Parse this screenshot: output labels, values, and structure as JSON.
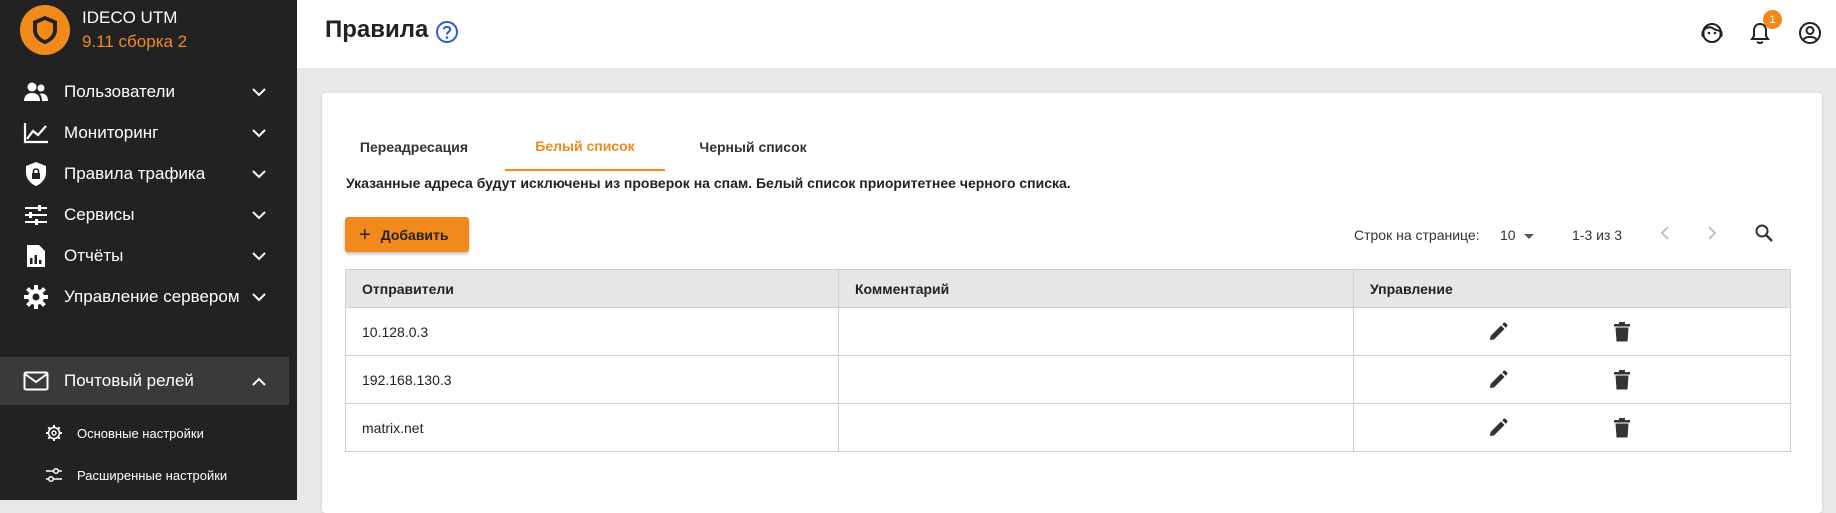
{
  "brand": {
    "name": "IDECO UTM",
    "version": "9.11 сборка 2"
  },
  "sidebar": {
    "items": [
      {
        "label": "Пользователи",
        "icon": "users-icon"
      },
      {
        "label": "Мониторинг",
        "icon": "chart-line-icon"
      },
      {
        "label": "Правила трафика",
        "icon": "shield-lock-icon"
      },
      {
        "label": "Сервисы",
        "icon": "sliders-icon"
      },
      {
        "label": "Отчёты",
        "icon": "report-icon"
      },
      {
        "label": "Управление сервером",
        "icon": "gear-icon"
      },
      {
        "label": "Почтовый релей",
        "icon": "mail-icon"
      }
    ],
    "subitems": [
      {
        "label": "Основные настройки",
        "icon": "gear-icon"
      },
      {
        "label": "Расширенные настройки",
        "icon": "sliders-icon"
      }
    ]
  },
  "header": {
    "title": "Правила",
    "notifications_count": "1"
  },
  "tabs": [
    "Переадресация",
    "Белый список",
    "Черный список"
  ],
  "description": "Указанные адреса будут исключены из проверок на спам. Белый список приоритетнее черного списка.",
  "toolbar": {
    "add_label": "Добавить",
    "rows_per_page_label": "Строк на странице:",
    "rows_per_page_value": "10",
    "range": "1-3 из 3"
  },
  "table": {
    "columns": [
      "Отправители",
      "Комментарий",
      "Управление"
    ],
    "rows": [
      {
        "sender": "10.128.0.3",
        "comment": ""
      },
      {
        "sender": "192.168.130.3",
        "comment": ""
      },
      {
        "sender": "matrix.net",
        "comment": ""
      }
    ]
  },
  "colors": {
    "accent": "#f28a1b",
    "sidebar": "#222222"
  }
}
